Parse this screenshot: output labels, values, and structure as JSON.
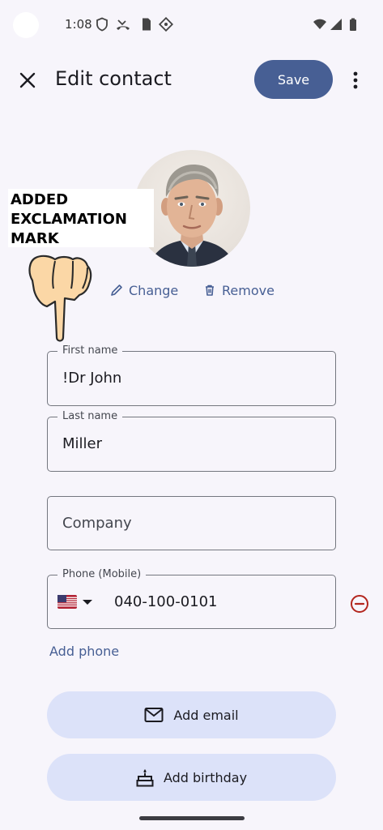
{
  "status_bar": {
    "time": "1:08",
    "icons": [
      "shield-icon",
      "missed-call-icon",
      "sim-card-icon",
      "location-diamond-icon",
      "wifi-icon",
      "signal-icon",
      "battery-icon"
    ]
  },
  "app_bar": {
    "title": "Edit contact",
    "save_label": "Save",
    "icons": [
      "close-icon",
      "more-vert-icon"
    ]
  },
  "annotation": {
    "lines": [
      "ADDED",
      "EXCLAMATION",
      "MARK"
    ]
  },
  "photo_actions": {
    "change_label": "Change",
    "remove_label": "Remove"
  },
  "form": {
    "first_name": {
      "label": "First name",
      "value": "!Dr John"
    },
    "last_name": {
      "label": "Last name",
      "value": "Miller"
    },
    "company": {
      "placeholder": "Company"
    },
    "phone": {
      "label": "Phone (Mobile)",
      "value": "040-100-0101",
      "country_flag": "US"
    },
    "add_phone_label": "Add phone",
    "add_email_label": "Add email",
    "add_birthday_label": "Add birthday"
  },
  "colors": {
    "accent": "#475f94",
    "background": "#f7f5fb",
    "pill_background": "#dce2f9",
    "remove_red": "#b3261e"
  }
}
